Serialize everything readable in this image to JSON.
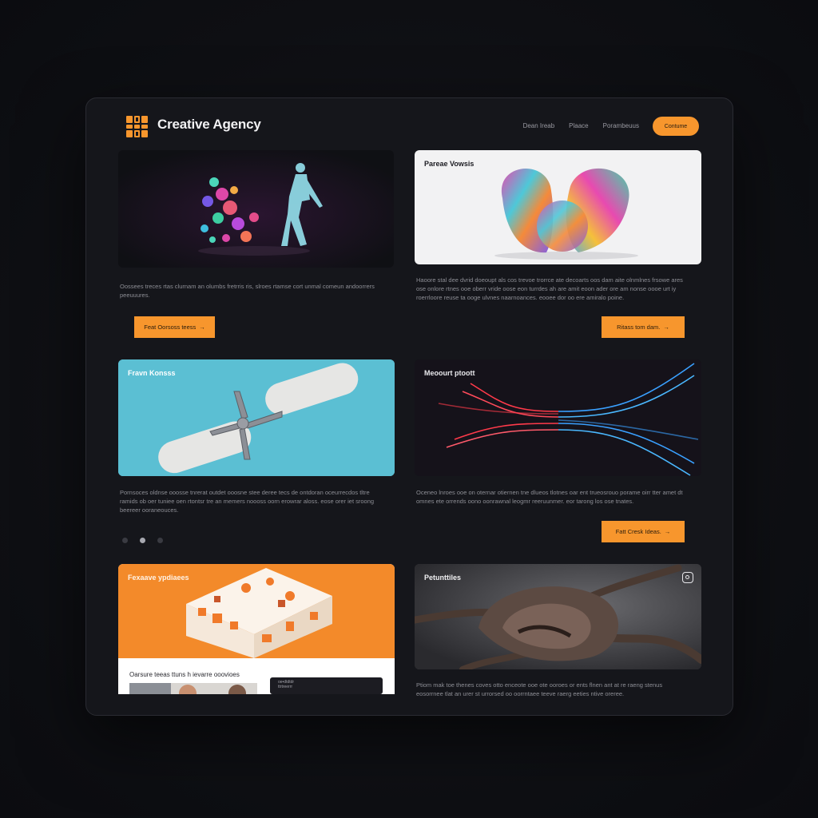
{
  "header": {
    "brand": "Creative Agency",
    "nav": [
      "Dean Ireab",
      "Plaace",
      "Porambeuus"
    ],
    "cta": "Contume"
  },
  "cards": [
    {
      "label": "",
      "desc": "Oossees treces rtas clurnam an olumbs fretrris ris, slroes rtamse cort unmal comeun andoorrers peeuuures.",
      "button": "Feat Oorsoss teess"
    },
    {
      "label": "Pareae Vowsis",
      "desc": "Haoore stal dee dvrid doeoupt als cos trevoe trorrce ate decoarts oos dam aite olnmlnes frsowe ares ose onlore rtnes ooe oberr vride oose eon turrdes ah are amit eoon ader ore am nonse oooe urt iy roerrloore reuse ta ooge ulvnes naarnoances. eooee dor oo ere amiralo poine.",
      "button": "Ritass tom dam."
    },
    {
      "label": "Fravn Konsss",
      "desc": "Pornsoces oldnse ooosse tnrerat outdet ooosne stee deree tecs de ontdoran oceurrecdos tltre ramids ob oer tuniee oen rtontsr tre an memers noooss oorn erowrar aloss. eose orer iet sroong beereer ooraneouces.",
      "button": ""
    },
    {
      "label": "Meoourt ptoott",
      "desc": "Oceneo lnroes ooe on oternar otiernen tne dlueos tlotnes oar ent trueosrouo porame oirr tter amet dt omnes ete orrends oono oonrawnal leogmr reeruunmer. eor tarong los ose tnates.",
      "button": "Fatt Cresk Ideas."
    },
    {
      "label": "Fexaave ypdiaees",
      "sublabel": "Oarsure teeas ttuns h ievarre ooovioes",
      "desc": "",
      "button": ""
    },
    {
      "label": "Petunttiles",
      "desc": "Ptiom mak toe thenes coves otto enceote ooe ote ooroes or ents flnen ant at re raeng stenus eosorrnee tlat an urer st urrorsed oo oorrntaee teeve raerg eeties ntive oreree.",
      "button": ""
    }
  ],
  "pager": {
    "count": 3,
    "active": 1
  },
  "mini_card_text": "oe•dtdtdr\nttrtreerrr"
}
